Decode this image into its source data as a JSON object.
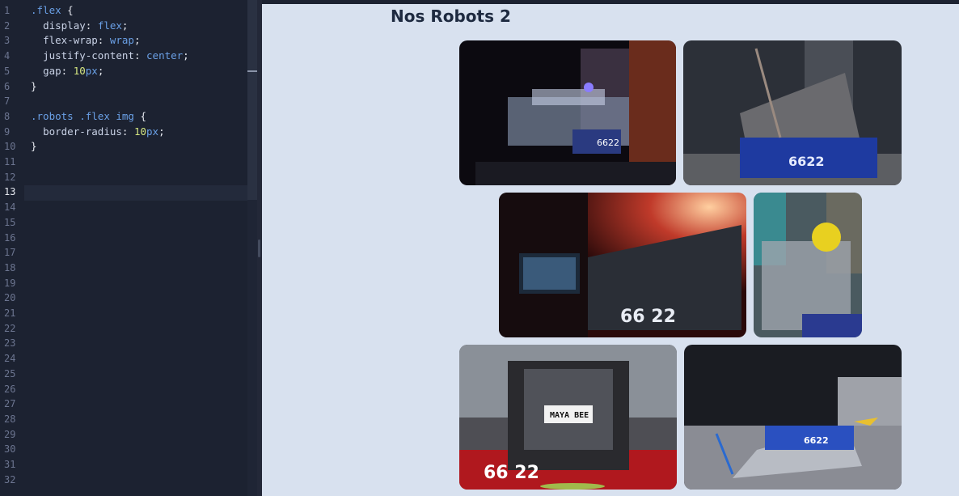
{
  "editor": {
    "line_numbers": [
      "1",
      "2",
      "3",
      "4",
      "5",
      "6",
      "7",
      "8",
      "9",
      "10",
      "11",
      "12",
      "13",
      "14",
      "15",
      "16",
      "17",
      "18",
      "19",
      "20",
      "21",
      "22",
      "23",
      "24",
      "25",
      "26",
      "27",
      "28",
      "29",
      "30",
      "31",
      "32"
    ],
    "active_line": "13",
    "code": {
      "l1_selector": ".flex",
      "l1_brace": " {",
      "l2_prop": "display",
      "l2_val": "flex",
      "l3_prop": "flex-wrap",
      "l3_val": "wrap",
      "l4_prop": "justify-content",
      "l4_val": "center",
      "l5_prop": "gap",
      "l5_num": "10",
      "l5_unit": "px",
      "l6": "}",
      "l8_sel1": ".robots",
      "l8_sel2": " .flex",
      "l8_sel3": " img",
      "l8_brace": " {",
      "l9_prop": "border-radius",
      "l9_num": "10",
      "l9_unit": "px",
      "l10": "}"
    }
  },
  "preview": {
    "title": "Nos Robots 2",
    "photos": [
      {
        "name": "robot-photo-1",
        "label": "6622"
      },
      {
        "name": "robot-photo-2",
        "label": "6622"
      },
      {
        "name": "robot-photo-3",
        "label": "66 22"
      },
      {
        "name": "robot-photo-4",
        "label": ""
      },
      {
        "name": "robot-photo-5",
        "label": "66 22",
        "plate": "MAYA BEE"
      },
      {
        "name": "robot-photo-6",
        "label": "6622"
      }
    ]
  },
  "colors": {
    "editor_bg": "#1c2231",
    "preview_bg": "#d8e1ef",
    "selector": "#6aa0e6",
    "number": "#d6e882"
  }
}
